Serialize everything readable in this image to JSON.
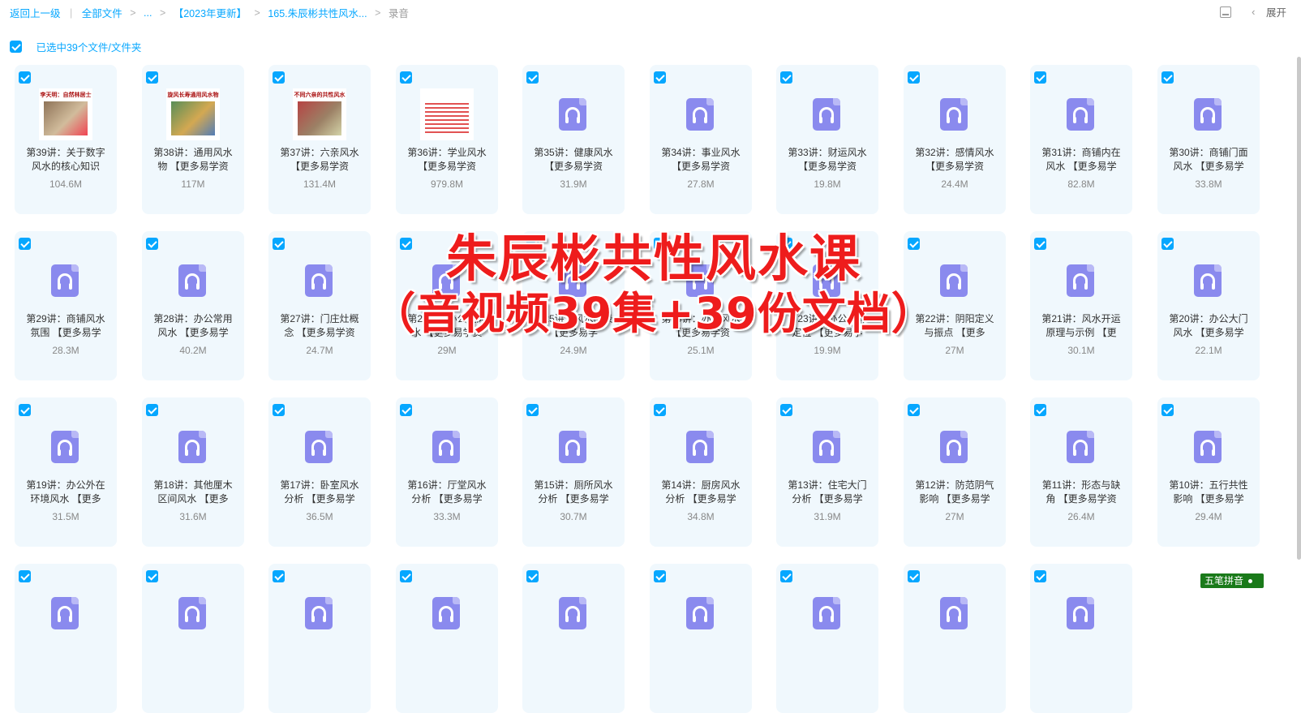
{
  "breadcrumb": {
    "back": "返回上一级",
    "all_files": "全部文件",
    "ellipsis": "...",
    "year_folder": "【2023年更新】",
    "course_folder": "165.朱辰彬共性风水...",
    "current": "录音"
  },
  "toolbar": {
    "expand": "展开",
    "list_icon": "list-view-icon",
    "chevron": "chevron-left-icon"
  },
  "selection": {
    "text": "已选中39个文件/文件夹",
    "checked": true
  },
  "colors": {
    "accent": "#06a7ff",
    "audio_icon": "#8a8aee",
    "card_bg": "#f0f8fd",
    "watermark": "#ee1c1c"
  },
  "files": [
    {
      "name": "第39讲：关于数字风水的核心知识",
      "size": "104.6M",
      "type": "image"
    },
    {
      "name": "第38讲：通用风水物 【更多易学资",
      "size": "117M",
      "type": "image"
    },
    {
      "name": "第37讲：六亲风水 【更多易学资",
      "size": "131.4M",
      "type": "image"
    },
    {
      "name": "第36讲：学业风水 【更多易学资",
      "size": "979.8M",
      "type": "image"
    },
    {
      "name": "第35讲：健康风水 【更多易学资",
      "size": "31.9M",
      "type": "audio"
    },
    {
      "name": "第34讲：事业风水 【更多易学资",
      "size": "27.8M",
      "type": "audio"
    },
    {
      "name": "第33讲：财运风水 【更多易学资",
      "size": "19.8M",
      "type": "audio"
    },
    {
      "name": "第32讲：感情风水 【更多易学资",
      "size": "24.4M",
      "type": "audio"
    },
    {
      "name": "第31讲：商铺内在风水 【更多易学",
      "size": "82.8M",
      "type": "audio"
    },
    {
      "name": "第30讲：商铺门面风水 【更多易学",
      "size": "33.8M",
      "type": "audio"
    },
    {
      "name": "第29讲：商铺风水氛围 【更多易学",
      "size": "28.3M",
      "type": "audio"
    },
    {
      "name": "第28讲：办公常用风水 【更多易学",
      "size": "40.2M",
      "type": "audio"
    },
    {
      "name": "第27讲：门庄灶概念 【更多易学资",
      "size": "24.7M",
      "type": "audio"
    },
    {
      "name": "第26讲：办公室风水 【更多易学资",
      "size": "29M",
      "type": "audio"
    },
    {
      "name": "第25讲：风水的录 【更多易学",
      "size": "24.9M",
      "type": "audio"
    },
    {
      "name": "第24讲：办公风水 【更多易学资",
      "size": "25.1M",
      "type": "audio"
    },
    {
      "name": "第23讲：办公利弊定位 【更多易学",
      "size": "19.9M",
      "type": "audio"
    },
    {
      "name": "第22讲：阴阳定义与振点 【更多",
      "size": "27M",
      "type": "audio"
    },
    {
      "name": "第21讲：风水开运原理与示例 【更",
      "size": "30.1M",
      "type": "audio"
    },
    {
      "name": "第20讲：办公大门风水 【更多易学",
      "size": "22.1M",
      "type": "audio"
    },
    {
      "name": "第19讲：办公外在环境风水 【更多",
      "size": "31.5M",
      "type": "audio"
    },
    {
      "name": "第18讲：其他厘木区间风水 【更多",
      "size": "31.6M",
      "type": "audio"
    },
    {
      "name": "第17讲：卧室风水分析 【更多易学",
      "size": "36.5M",
      "type": "audio"
    },
    {
      "name": "第16讲：厅堂风水分析 【更多易学",
      "size": "33.3M",
      "type": "audio"
    },
    {
      "name": "第15讲：厕所风水分析 【更多易学",
      "size": "30.7M",
      "type": "audio"
    },
    {
      "name": "第14讲：厨房风水分析 【更多易学",
      "size": "34.8M",
      "type": "audio"
    },
    {
      "name": "第13讲：住宅大门分析 【更多易学",
      "size": "31.9M",
      "type": "audio"
    },
    {
      "name": "第12讲：防范阴气影响 【更多易学",
      "size": "27M",
      "type": "audio"
    },
    {
      "name": "第11讲：形态与缺角 【更多易学资",
      "size": "26.4M",
      "type": "audio"
    },
    {
      "name": "第10讲：五行共性影响 【更多易学",
      "size": "29.4M",
      "type": "audio"
    },
    {
      "name": "",
      "size": "",
      "type": "audio"
    },
    {
      "name": "",
      "size": "",
      "type": "audio"
    },
    {
      "name": "",
      "size": "",
      "type": "audio"
    },
    {
      "name": "",
      "size": "",
      "type": "audio"
    },
    {
      "name": "",
      "size": "",
      "type": "audio"
    },
    {
      "name": "",
      "size": "",
      "type": "audio"
    },
    {
      "name": "",
      "size": "",
      "type": "audio"
    },
    {
      "name": "",
      "size": "",
      "type": "audio"
    },
    {
      "name": "",
      "size": "",
      "type": "audio"
    }
  ],
  "thumb_texts": [
    "李天明：自然林居士",
    "旋风长寿通用风水物",
    "不同六亲的共性风水",
    ""
  ],
  "watermark": {
    "line1": "朱辰彬共性风水课",
    "line2": "（音视频39集+39份文档）"
  },
  "ime": {
    "label": "五笔拼音"
  }
}
